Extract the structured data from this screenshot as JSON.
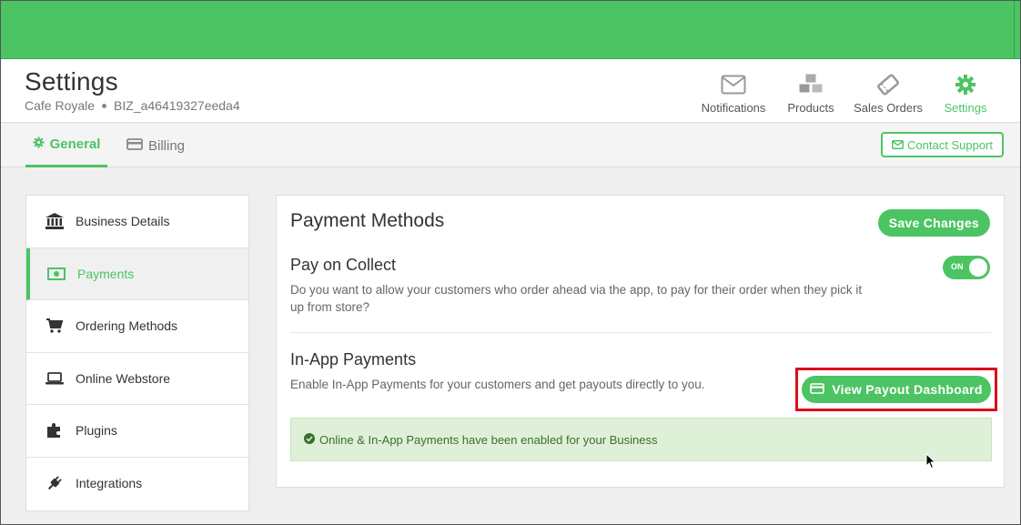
{
  "header": {
    "title": "Settings",
    "business_name": "Cafe Royale",
    "business_id": "BIZ_a46419327eeda4"
  },
  "top_nav": {
    "notifications": "Notifications",
    "products": "Products",
    "sales_orders": "Sales Orders",
    "settings": "Settings"
  },
  "tabs": {
    "general": "General",
    "billing": "Billing"
  },
  "contact_support": "Contact Support",
  "sidebar": {
    "items": [
      {
        "label": "Business Details",
        "icon": "bank-icon"
      },
      {
        "label": "Payments",
        "icon": "money-icon"
      },
      {
        "label": "Ordering Methods",
        "icon": "cart-icon"
      },
      {
        "label": "Online Webstore",
        "icon": "laptop-icon"
      },
      {
        "label": "Plugins",
        "icon": "puzzle-icon"
      },
      {
        "label": "Integrations",
        "icon": "plug-icon"
      }
    ]
  },
  "panel": {
    "title": "Payment Methods",
    "save_label": "Save Changes",
    "pay_on_collect": {
      "title": "Pay on Collect",
      "description": "Do you want to allow your customers who order ahead via the app, to pay for their order when they pick it up from store?",
      "toggle_label": "ON",
      "toggle_on": true
    },
    "in_app": {
      "title": "In-App Payments",
      "description": "Enable In-App Payments for your customers and get payouts directly to you.",
      "payout_button": "View Payout Dashboard",
      "alert": "Online & In-App Payments have been enabled for your Business"
    }
  },
  "colors": {
    "brand_green": "#4cc463",
    "highlight_red": "#d9101a",
    "alert_bg": "#dff0d8"
  }
}
